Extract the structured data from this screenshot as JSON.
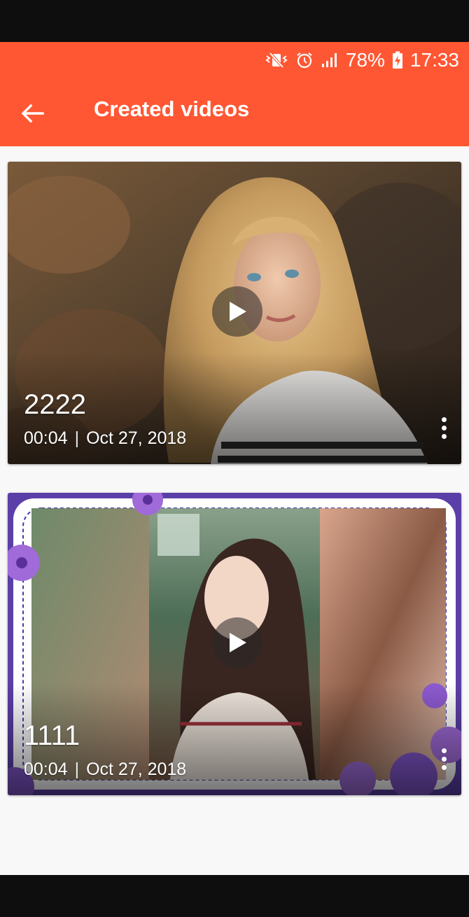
{
  "status_bar": {
    "battery": "78%",
    "time": "17:33"
  },
  "header": {
    "title": "Created videos"
  },
  "videos": [
    {
      "name": "2222",
      "duration": "00:04",
      "separator": "|",
      "date": "Oct 27, 2018"
    },
    {
      "name": "1111",
      "duration": "00:04",
      "separator": "|",
      "date": "Oct 27, 2018"
    }
  ],
  "colors": {
    "accent": "#ff5733",
    "background": "#f8f8f8"
  }
}
